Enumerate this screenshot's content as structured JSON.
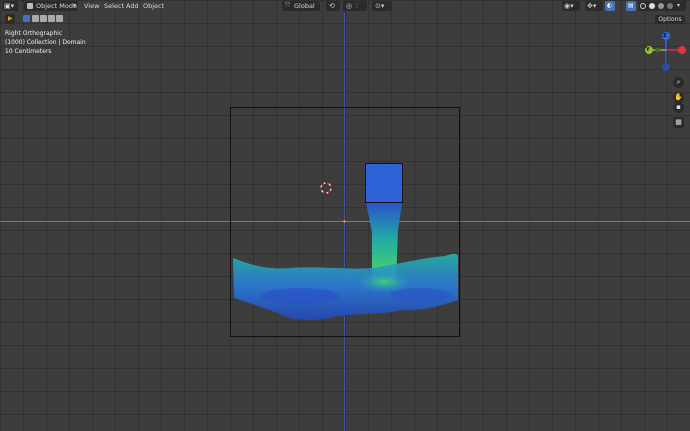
{
  "header": {
    "mode_label": "Object Mode",
    "menu": [
      "View",
      "Select",
      "Add",
      "Object"
    ],
    "transform_orientation": "Global",
    "options_label": "Options"
  },
  "overlay": {
    "view_name": "Right Orthographic",
    "collection_info": "(1000) Collection | Domain",
    "scale_info": "10 Centimeters"
  },
  "gizmo": {
    "z_label": "Z",
    "y_label": "Y",
    "colors": {
      "x": "#e0353e",
      "y": "#8ec32f",
      "z": "#2f6ae0"
    }
  },
  "colors": {
    "accent": "#4772b3",
    "x_axis_line": "#6d8e2c",
    "z_axis_line": "#3a54a8",
    "domain_box": "#000000",
    "fluid_low": "#2e58d8",
    "fluid_mid": "#20a8c8",
    "fluid_high": "#4ad868"
  },
  "icons": [
    "editor-type-icon",
    "mode-icon",
    "select-box-icon",
    "transform-pivot-icon",
    "snap-icon",
    "proportional-edit-icon",
    "visibility-icon",
    "gizmo-icon",
    "overlay-icon",
    "xray-icon",
    "shading-icons",
    "zoom-icon",
    "hand-icon",
    "camera-icon",
    "grid-icon",
    "play-icon",
    "3d-cursor-icon"
  ]
}
